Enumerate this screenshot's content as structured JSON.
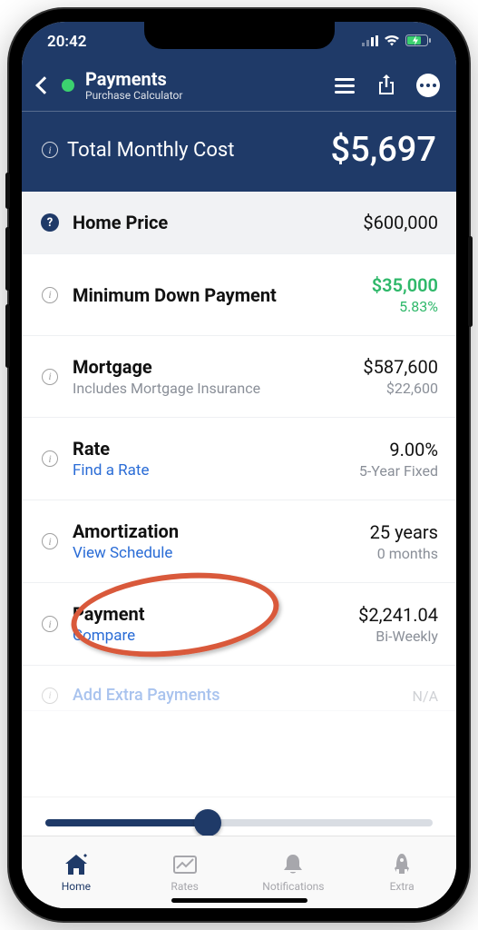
{
  "status": {
    "time": "20:42"
  },
  "nav": {
    "title": "Payments",
    "subtitle": "Purchase Calculator"
  },
  "summary": {
    "label": "Total Monthly Cost",
    "value": "$5,697"
  },
  "rows": {
    "home_price": {
      "label": "Home Price",
      "value": "$600,000"
    },
    "down_payment": {
      "label": "Minimum Down Payment",
      "value": "$35,000",
      "pct": "5.83%"
    },
    "mortgage": {
      "label": "Mortgage",
      "sub": "Includes Mortgage Insurance",
      "value": "$587,600",
      "value_sub": "$22,600"
    },
    "rate": {
      "label": "Rate",
      "link": "Find a Rate",
      "value": "9.00%",
      "value_sub": "5-Year Fixed"
    },
    "amortization": {
      "label": "Amortization",
      "link": "View Schedule",
      "value": "25 years",
      "value_sub": "0 months"
    },
    "payment": {
      "label": "Payment",
      "link": "Compare",
      "value": "$2,241.04",
      "value_sub": "Bi-Weekly"
    },
    "extra": {
      "label": "Add Extra Payments",
      "value": "N/A"
    }
  },
  "tabs": {
    "home": "Home",
    "rates": "Rates",
    "notifications": "Notifications",
    "extra": "Extra"
  }
}
